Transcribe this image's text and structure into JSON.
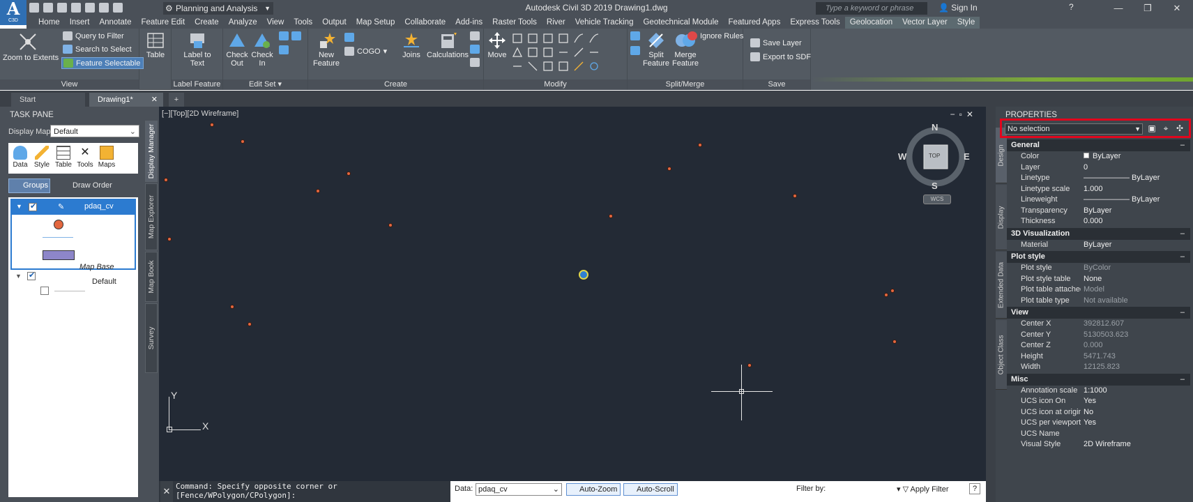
{
  "title_bar": {
    "app_logo": "A",
    "app_logo_sub": "C3D",
    "workspace": "Planning and Analysis",
    "window_title": "Autodesk Civil 3D 2019    Drawing1.dwg",
    "search_placeholder": "Type a keyword or phrase",
    "sign_in": "Sign In"
  },
  "menu": [
    "Home",
    "Insert",
    "Annotate",
    "Feature Edit",
    "Create",
    "Analyze",
    "View",
    "Tools",
    "Output",
    "Map Setup",
    "Collaborate",
    "Add-ins",
    "Raster Tools",
    "River",
    "Vehicle Tracking",
    "Geotechnical Module",
    "Featured Apps",
    "Express Tools",
    "Geolocation",
    "Vector Layer",
    "Style"
  ],
  "ribbon": {
    "view": {
      "title": "View",
      "zoom": "Zoom to Extents",
      "query": "Query to Filter",
      "search": "Search to Select",
      "feature_selectable": "Feature Selectable"
    },
    "table": "Table",
    "label_feature": {
      "title": "Label Feature",
      "label": "Label to Text"
    },
    "edit_set": {
      "title": "Edit Set",
      "check_out": "Check Out",
      "check_in": "Check In"
    },
    "create": {
      "title": "Create",
      "new_feature": "New Feature",
      "cogo": "COGO",
      "joins": "Joins",
      "calculations": "Calculations"
    },
    "modify": {
      "title": "Modify",
      "move": "Move"
    },
    "split_merge": {
      "title": "Split/Merge",
      "split": "Split Feature",
      "merge": "Merge Feature",
      "ignore_rules": "Ignore Rules"
    },
    "save": {
      "title": "Save",
      "save_layer": "Save Layer",
      "export": "Export to SDF"
    }
  },
  "doc_tabs": {
    "start": "Start",
    "drawing": "Drawing1*"
  },
  "task_pane": {
    "title": "TASK PANE",
    "display_map_label": "Display Map:",
    "display_map_value": "Default",
    "tools": [
      "Data",
      "Style",
      "Table",
      "Tools",
      "Maps"
    ],
    "groups": "Groups",
    "draw_order": "Draw Order",
    "layer_name": "pdaq_cv",
    "map_base": "Map Base",
    "default_layer": "Default",
    "side_tabs": [
      "Display Manager",
      "Map Explorer",
      "Map Book",
      "Survey"
    ]
  },
  "viewport": {
    "label": "[−][Top][2D Wireframe]",
    "compass": {
      "n": "N",
      "s": "S",
      "e": "E",
      "w": "W",
      "top": "TOP",
      "wcs": "WCS"
    },
    "ucs_y": "Y",
    "ucs_x": "X"
  },
  "command_line": "Command: Specify opposite corner or [Fence/WPolygon/CPolygon]:",
  "data_bar": {
    "data_label": "Data:",
    "data_value": "pdaq_cv",
    "auto_zoom": "Auto-Zoom",
    "auto_scroll": "Auto-Scroll",
    "filter_by": "Filter by:",
    "apply_filter": "Apply Filter"
  },
  "properties": {
    "title": "PROPERTIES",
    "selection": "No selection",
    "side_tabs": [
      "Design",
      "Display",
      "Extended Data",
      "Object Class"
    ],
    "sections": [
      {
        "name": "General",
        "rows": [
          {
            "k": "Color",
            "v": "ByLayer"
          },
          {
            "k": "Layer",
            "v": "0"
          },
          {
            "k": "Linetype",
            "v": "—————— ByLayer"
          },
          {
            "k": "Linetype scale",
            "v": "1.000"
          },
          {
            "k": "Lineweight",
            "v": "—————— ByLayer"
          },
          {
            "k": "Transparency",
            "v": "ByLayer"
          },
          {
            "k": "Thickness",
            "v": "0.000"
          }
        ]
      },
      {
        "name": "3D Visualization",
        "rows": [
          {
            "k": "Material",
            "v": "ByLayer"
          }
        ]
      },
      {
        "name": "Plot style",
        "rows": [
          {
            "k": "Plot style",
            "v": "ByColor",
            "dim": true
          },
          {
            "k": "Plot style table",
            "v": "None"
          },
          {
            "k": "Plot table attached...",
            "v": "Model",
            "dim": true
          },
          {
            "k": "Plot table type",
            "v": "Not available",
            "dim": true
          }
        ]
      },
      {
        "name": "View",
        "rows": [
          {
            "k": "Center X",
            "v": "392812.607",
            "dim": true
          },
          {
            "k": "Center Y",
            "v": "5130503.623",
            "dim": true
          },
          {
            "k": "Center Z",
            "v": "0.000",
            "dim": true
          },
          {
            "k": "Height",
            "v": "5471.743",
            "dim": true
          },
          {
            "k": "Width",
            "v": "12125.823",
            "dim": true
          }
        ]
      },
      {
        "name": "Misc",
        "rows": [
          {
            "k": "Annotation scale",
            "v": "1:1000"
          },
          {
            "k": "UCS icon On",
            "v": "Yes"
          },
          {
            "k": "UCS icon at origin",
            "v": "No"
          },
          {
            "k": "UCS per viewport",
            "v": "Yes"
          },
          {
            "k": "UCS Name",
            "v": ""
          },
          {
            "k": "Visual Style",
            "v": "2D Wireframe"
          }
        ]
      }
    ]
  },
  "colors": {
    "accent": "#2c7bd0",
    "point": "#e3673f",
    "highlight_box": "#e2061d",
    "viewport_bg": "#232a35"
  }
}
